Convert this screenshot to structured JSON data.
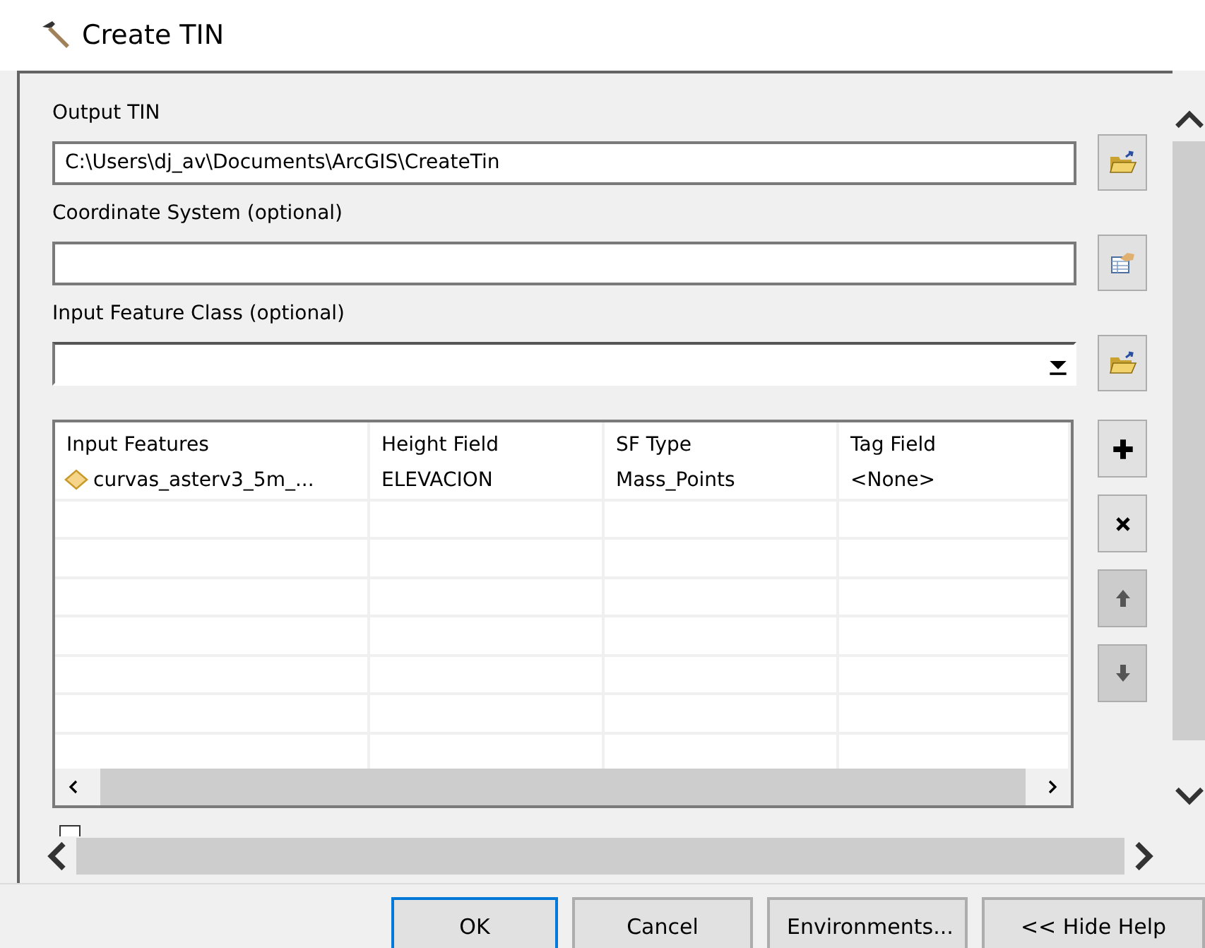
{
  "window": {
    "title": "Create TIN"
  },
  "fields": [
    {
      "label": "Output TIN",
      "kind": "path",
      "value": "C:\\Users\\dj_av\\Documents\\ArcGIS\\CreateTin"
    },
    {
      "label": "Coordinate System (optional)",
      "kind": "spatial_reference"
    },
    {
      "label": "Input Feature Class (optional)",
      "kind": "feature_class"
    }
  ],
  "table": {
    "columns": [
      "Input Features",
      "Height Field",
      "SF Type",
      "Tag Field"
    ],
    "rows": [
      {
        "cells": [
          "curvas_asterv3_5m_...",
          "ELEVACION",
          "Mass_Points",
          "<None>"
        ]
      }
    ]
  },
  "table_buttons": [
    {
      "kind": "add",
      "disabled": false
    },
    {
      "kind": "remove",
      "disabled": false
    },
    {
      "kind": "up",
      "disabled": true
    },
    {
      "kind": "down",
      "disabled": true
    }
  ],
  "checkbox": {
    "checked": false
  },
  "buttons": [
    {
      "label": "OK",
      "default": true
    },
    {
      "label": "Cancel",
      "default": false
    },
    {
      "label": "Environments...",
      "default": false
    },
    {
      "label": "<< Hide Help",
      "default": false
    }
  ]
}
